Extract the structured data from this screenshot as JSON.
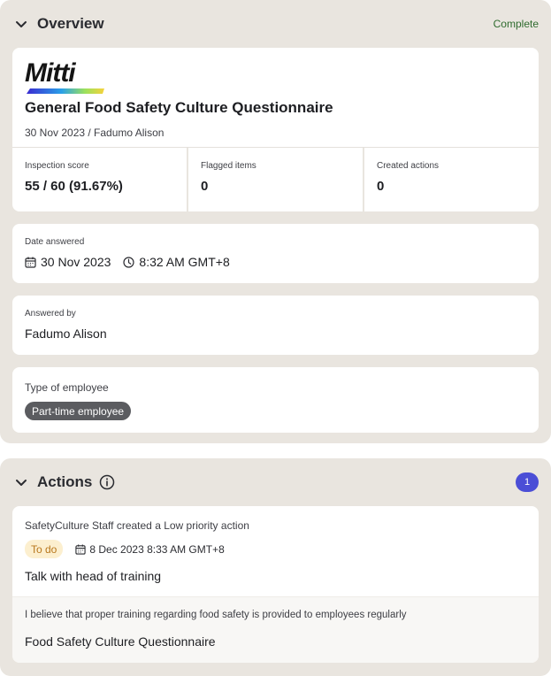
{
  "overview": {
    "title": "Overview",
    "status": "Complete",
    "logo_text": "Mitti",
    "report_title": "General Food Safety Culture Questionnaire",
    "report_subtitle": "30 Nov 2023 / Fadumo Alison",
    "stats": [
      {
        "label": "Inspection score",
        "value": "55 / 60 (91.67%)"
      },
      {
        "label": "Flagged items",
        "value": "0"
      },
      {
        "label": "Created actions",
        "value": "0"
      }
    ],
    "date_answered": {
      "label": "Date answered",
      "date": "30 Nov 2023",
      "time": "8:32 AM GMT+8"
    },
    "answered_by": {
      "label": "Answered by",
      "value": "Fadumo Alison"
    },
    "employee_type": {
      "label": "Type of employee",
      "value": "Part-time employee"
    }
  },
  "actions": {
    "title": "Actions",
    "count": "1",
    "items": [
      {
        "creator_text": "SafetyCulture Staff created a Low priority action",
        "status": "To do",
        "due": "8 Dec 2023 8:33 AM GMT+8",
        "title": "Talk with head of training",
        "question": "I believe that proper training regarding food safety is provided to employees regularly",
        "template": "Food Safety Culture Questionnaire"
      }
    ]
  },
  "colors": {
    "section_bg": "#e9e5df",
    "complete": "#2f6b2e",
    "badge": "#4b4ed6",
    "todo_bg": "#fcefcf",
    "todo_text": "#b8771d",
    "pill_bg": "#5b5c60"
  }
}
